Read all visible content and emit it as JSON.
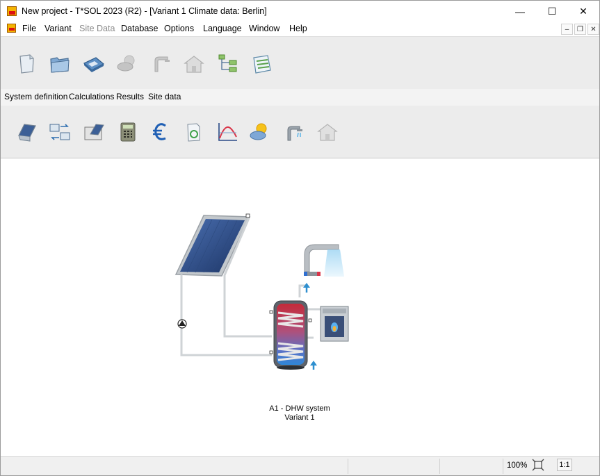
{
  "window": {
    "title": "New project - T*SOL 2023 (R2) - [Variant 1    Climate data: Berlin]",
    "controls": {
      "minimize": "—",
      "maximize": "☐",
      "close": "✕"
    }
  },
  "menu": {
    "items": [
      "File",
      "Variant",
      "Site Data",
      "Database",
      "Options",
      "Language",
      "Window",
      "Help"
    ],
    "mdi": {
      "minimize": "–",
      "restore": "❐",
      "close": "✕"
    }
  },
  "toolbar_top": {
    "icons": [
      "new-project-icon",
      "open-folder-icon",
      "save-disk-icon",
      "weather-cloud-icon",
      "shower-icon",
      "house-icon",
      "tree-structure-icon",
      "report-list-icon"
    ]
  },
  "tabs": [
    "System definition",
    "Calculations",
    "Results",
    "Site data"
  ],
  "toolbar_bottom": {
    "icons": [
      "collector-field-icon",
      "compare-variants-icon",
      "system-selection-icon",
      "calculator-icon",
      "euro-icon",
      "document-recycle-icon",
      "curve-chart-icon",
      "sun-cloud-icon",
      "shower-tap-icon",
      "house-grey-icon"
    ]
  },
  "diagram": {
    "caption_line1": "A1 - DHW system",
    "caption_line2": "Variant 1",
    "colors": {
      "collector_frame": "#b0b4b8",
      "collector_glass": "#2a4a86",
      "pipe": "#cfd3d6",
      "tank_hot": "#d9364a",
      "tank_cold": "#3a7bd5",
      "arrow": "#2e8fcf"
    }
  },
  "status": {
    "zoom": "100%",
    "scale": "1:1"
  }
}
